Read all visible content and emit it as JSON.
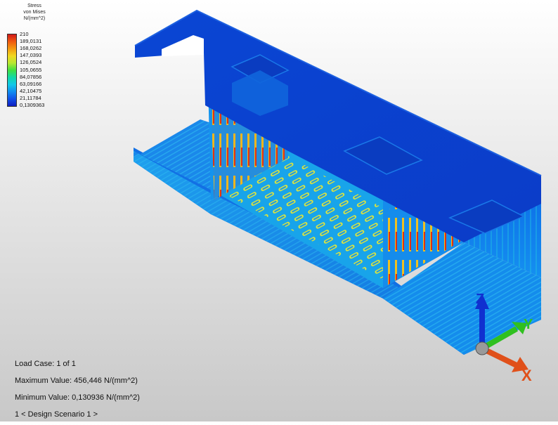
{
  "legend": {
    "title_lines": [
      "Stress",
      "von Mises",
      "N/(mm^2)"
    ],
    "labels": [
      "210",
      "189,0131",
      "168,0262",
      "147,0393",
      "126,0524",
      "105,0655",
      "84,07856",
      "63,09166",
      "42,10475",
      "21,11784",
      "0,1309363"
    ],
    "colors": [
      "#d01818",
      "#f05a10",
      "#f49a10",
      "#f0d820",
      "#b8e830",
      "#40e040",
      "#10d8a8",
      "#10c8e8",
      "#108cf0",
      "#1050e8",
      "#1020c0"
    ]
  },
  "info": {
    "load_case": "Load Case:  1 of 1",
    "max_value": "Maximum Value: 456,446 N/(mm^2)",
    "min_value": "Minimum Value: 0,130936 N/(mm^2)",
    "scenario": "1 < Design Scenario 1 >"
  },
  "axes": {
    "x_label": "X",
    "y_label": "Y",
    "z_label": "Z",
    "x_color": "#e0501a",
    "y_color": "#30c020",
    "z_color": "#1030d0"
  }
}
